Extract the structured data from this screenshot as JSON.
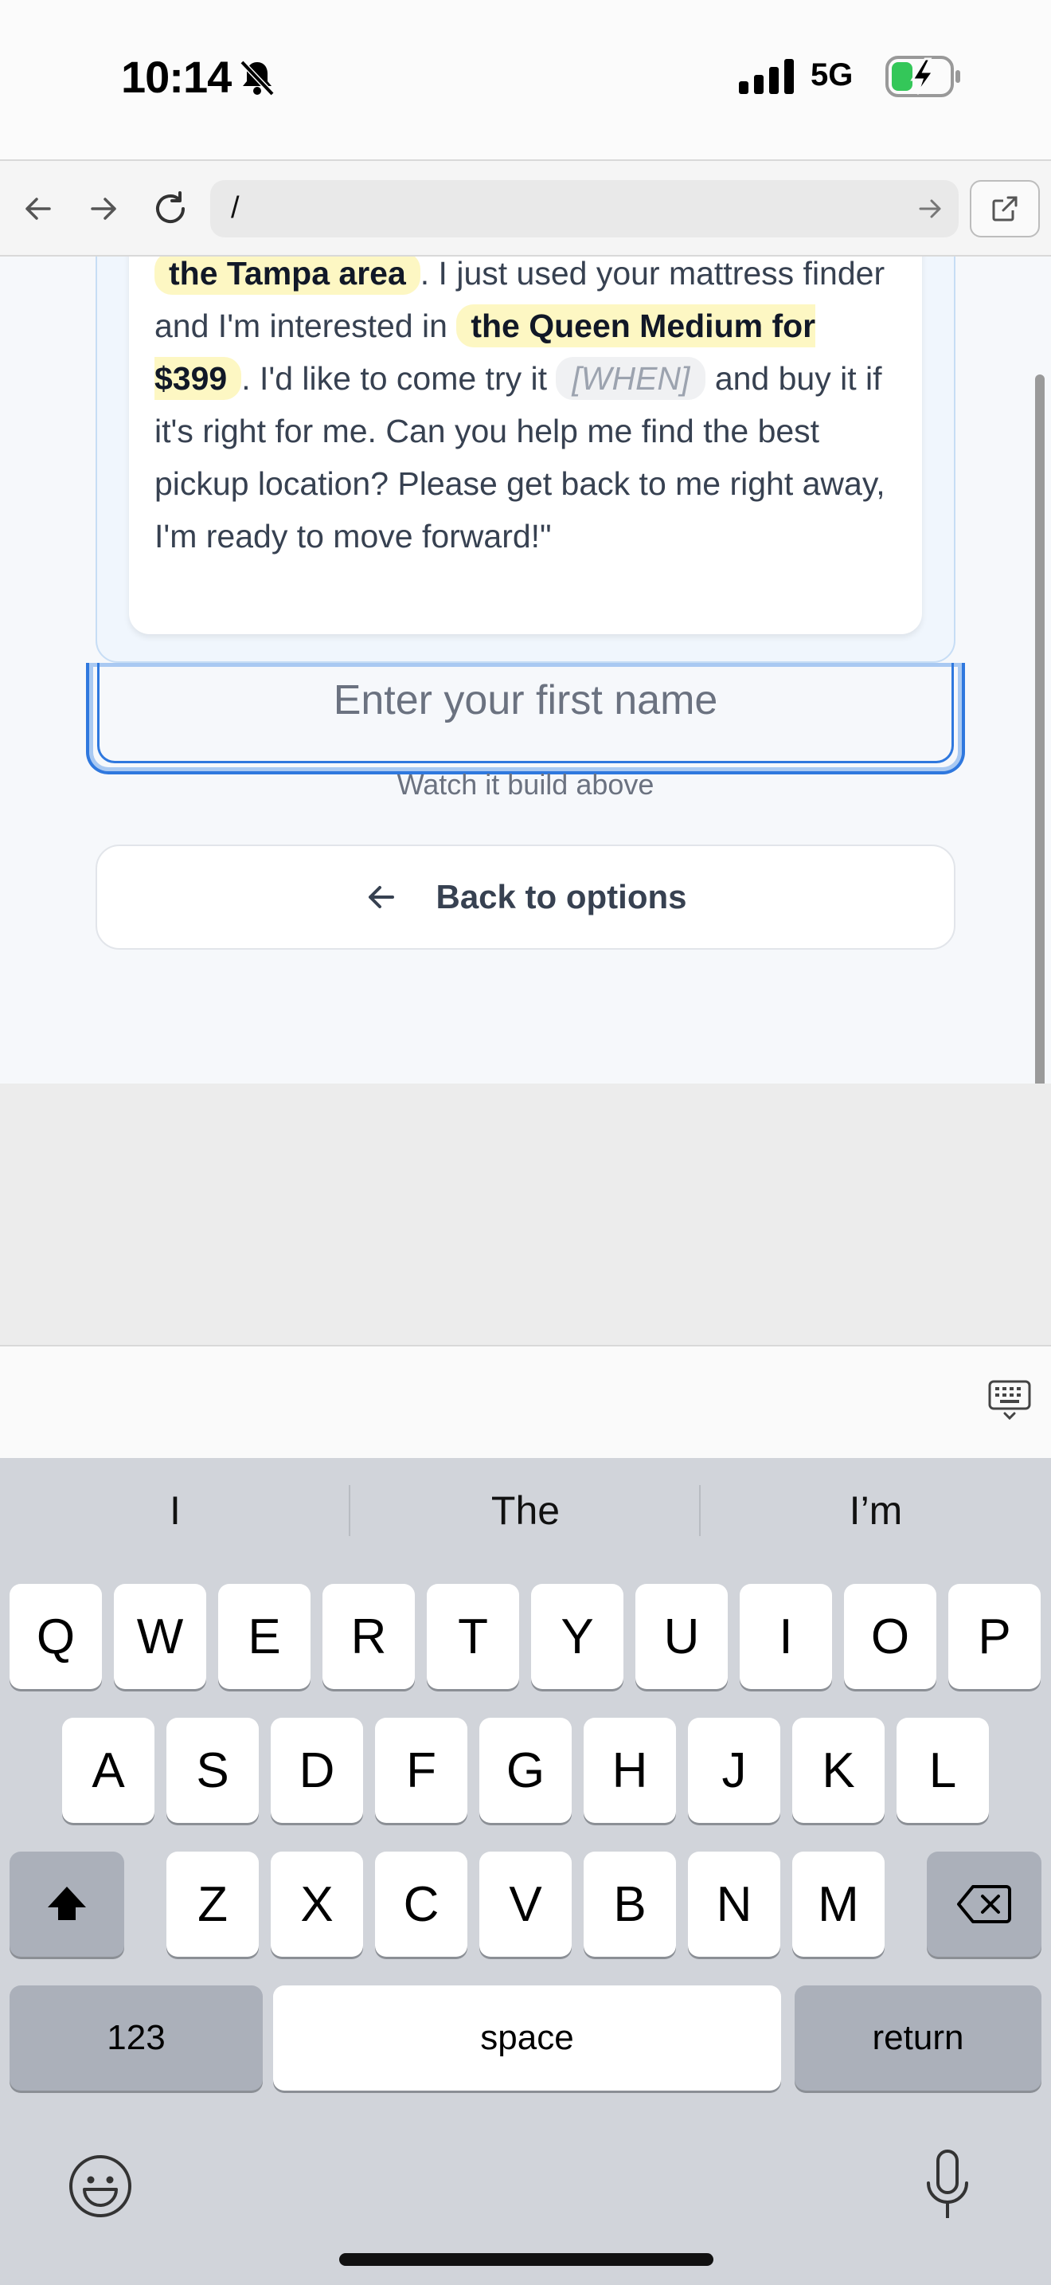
{
  "status_bar": {
    "time": "10:14",
    "network": "5G",
    "icons": [
      "bell-slash-icon",
      "signal-icon",
      "battery-charging-icon"
    ]
  },
  "browser": {
    "url": "/",
    "icons": [
      "back-arrow-icon",
      "forward-arrow-icon",
      "reload-icon",
      "go-arrow-icon",
      "open-external-icon"
    ]
  },
  "message": {
    "segments": [
      {
        "type": "hl",
        "text": "the Tampa area"
      },
      {
        "type": "text",
        "text": ". I just used your mattress finder and I'm interested in "
      },
      {
        "type": "hl",
        "text": "the Queen Medium for $399"
      },
      {
        "type": "text",
        "text": ". I'd like to come try it "
      },
      {
        "type": "ph",
        "text": "[WHEN]"
      },
      {
        "type": "text",
        "text": " and buy it if it's right for me. Can you help me find the best pickup location? Please get back to me right away, I'm ready to move forward!\""
      }
    ]
  },
  "name_field": {
    "placeholder": "Enter your first name"
  },
  "hint": "Watch it build above",
  "back_button": {
    "label": "Back to options"
  },
  "keyboard": {
    "suggestions": [
      "I",
      "The",
      "I’m"
    ],
    "row1": [
      "Q",
      "W",
      "E",
      "R",
      "T",
      "Y",
      "U",
      "I",
      "O",
      "P"
    ],
    "row2": [
      "A",
      "S",
      "D",
      "F",
      "G",
      "H",
      "J",
      "K",
      "L"
    ],
    "row3": [
      "Z",
      "X",
      "C",
      "V",
      "B",
      "N",
      "M"
    ],
    "numbers_label": "123",
    "space_label": "space",
    "return_label": "return"
  }
}
